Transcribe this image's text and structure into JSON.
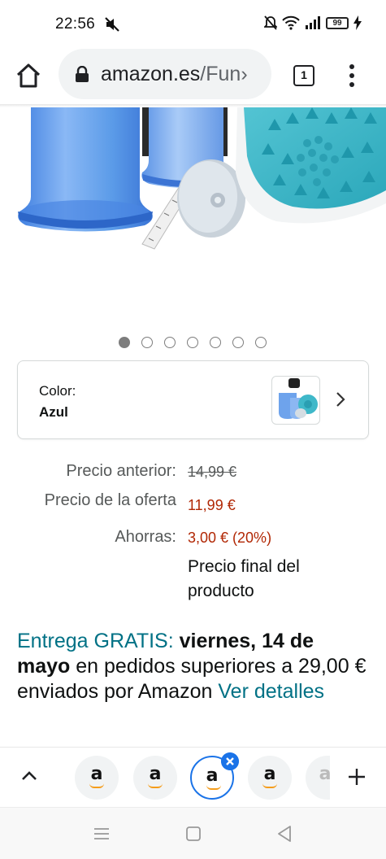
{
  "status_bar": {
    "time": "22:56",
    "battery": "99",
    "icons": [
      "mute-icon",
      "alarm-off-icon",
      "wifi-icon",
      "signal-icon",
      "battery-icon",
      "charging-icon"
    ]
  },
  "browser": {
    "url_domain": "amazon.es",
    "url_path": "/Fun›",
    "tab_count": "1",
    "icons": [
      "home-icon",
      "lock-icon",
      "tab-switcher-icon",
      "more-vert-icon"
    ]
  },
  "gallery": {
    "image_count": 7,
    "active_index": 0
  },
  "variation": {
    "label": "Color:",
    "value": "Azul"
  },
  "pricing": {
    "previous_label": "Precio anterior:",
    "previous_value": "14,99 €",
    "offer_label": "Precio de la oferta",
    "offer_value": "11,99 €",
    "savings_label": "Ahorras:",
    "savings_value": "3,00 € (20%)",
    "final_note": "Precio final del producto"
  },
  "delivery": {
    "free_label": "Entrega GRATIS:",
    "date": "viernes, 14 de mayo",
    "condition": "en pedidos superiores a 29,00 € enviados por Amazon",
    "details_link": "Ver detalles"
  },
  "tab_strip": {
    "tabs": [
      {
        "glyph": "a",
        "active": false
      },
      {
        "glyph": "a",
        "active": false
      },
      {
        "glyph": "a",
        "active": true
      },
      {
        "glyph": "a",
        "active": false
      },
      {
        "glyph": "a",
        "active": false
      }
    ]
  },
  "colors": {
    "teal_link": "#007185",
    "price_red": "#b12704",
    "chrome_blue": "#1a73e8",
    "product_blue": "#5b9be8",
    "product_teal": "#3fb8c9"
  }
}
